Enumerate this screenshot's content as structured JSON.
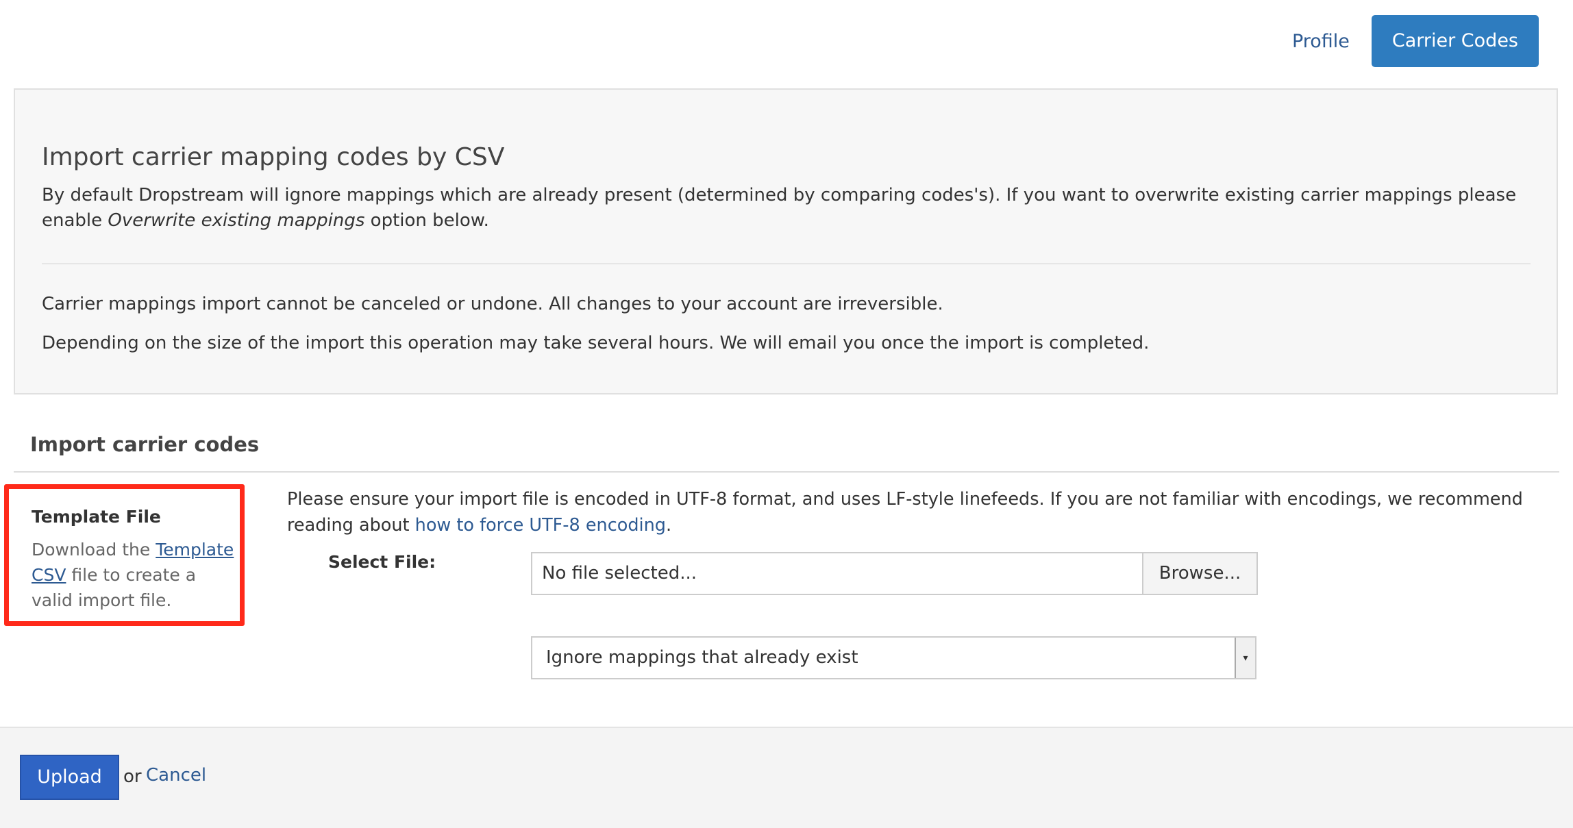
{
  "nav": {
    "profile_label": "Profile",
    "carrier_codes_label": "Carrier Codes"
  },
  "info": {
    "title": "Import carrier mapping codes by CSV",
    "p1_before": "By default Dropstream will ignore mappings which are already present (determined by comparing codes's). If you want to overwrite existing carrier mappings please enable ",
    "p1_emphasis": "Overwrite existing mappings",
    "p1_after": " option below.",
    "p2": "Carrier mappings import cannot be canceled or undone. All changes to your account are irreversible.",
    "p3": "Depending on the size of the import this operation may take several hours. We will email you once the import is completed."
  },
  "section": {
    "title": "Import carrier codes"
  },
  "template": {
    "title": "Template File",
    "text_before": "Download the ",
    "link_label": "Template CSV",
    "text_after": " file to create a valid import file."
  },
  "encoding": {
    "text_before": "Please ensure your import file is encoded in UTF-8 format, and uses LF-style linefeeds. If you are not familiar with encodings, we recommend reading about ",
    "link_label": "how to force UTF-8 encoding",
    "text_after": "."
  },
  "file": {
    "label": "Select File:",
    "value": "No file selected...",
    "browse_label": "Browse..."
  },
  "mode": {
    "selected": "Ignore mappings that already exist"
  },
  "footer": {
    "upload_label": "Upload",
    "or_text": "or",
    "cancel_label": "Cancel"
  },
  "colors": {
    "primary_button": "#2f64c4",
    "nav_button": "#2e7cbf",
    "link": "#2d5a92",
    "highlight_box": "#ff2a1a"
  }
}
